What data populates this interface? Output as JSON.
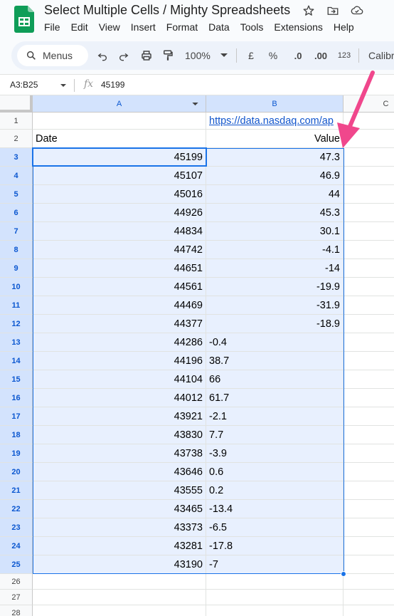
{
  "doc": {
    "title": "Select Multiple Cells / Mighty Spreadsheets",
    "star_icon": "star-icon",
    "move_icon": "move-to-folder-icon",
    "cloud_icon": "cloud-saved-icon"
  },
  "menubar": [
    "File",
    "Edit",
    "View",
    "Insert",
    "Format",
    "Data",
    "Tools",
    "Extensions",
    "Help"
  ],
  "toolbar": {
    "search_label": "Menus",
    "zoom": "100%",
    "currency": "£",
    "percent": "%",
    "decrease_decimal": ".0",
    "increase_decimal": ".00",
    "number_format": "123",
    "font": "Calibri"
  },
  "formula_bar": {
    "name_box": "A3:B25",
    "fx_symbol": "fx",
    "value": "45199"
  },
  "columns": [
    "A",
    "B",
    "C"
  ],
  "rows": [
    {
      "n": "1",
      "a": "",
      "b": "https://data.nasdaq.com/ap",
      "b_type": "link"
    },
    {
      "n": "2",
      "a": "Date",
      "a_type": "text",
      "b": "Value",
      "b_type": "num"
    },
    {
      "n": "3",
      "a": "45199",
      "b": "47.3",
      "b_type": "num"
    },
    {
      "n": "4",
      "a": "45107",
      "b": "46.9",
      "b_type": "num"
    },
    {
      "n": "5",
      "a": "45016",
      "b": "44",
      "b_type": "num"
    },
    {
      "n": "6",
      "a": "44926",
      "b": "45.3",
      "b_type": "num"
    },
    {
      "n": "7",
      "a": "44834",
      "b": "30.1",
      "b_type": "num"
    },
    {
      "n": "8",
      "a": "44742",
      "b": "-4.1",
      "b_type": "num"
    },
    {
      "n": "9",
      "a": "44651",
      "b": "-14",
      "b_type": "num"
    },
    {
      "n": "10",
      "a": "44561",
      "b": "-19.9",
      "b_type": "num"
    },
    {
      "n": "11",
      "a": "44469",
      "b": "-31.9",
      "b_type": "num"
    },
    {
      "n": "12",
      "a": "44377",
      "b": "-18.9",
      "b_type": "num"
    },
    {
      "n": "13",
      "a": "44286",
      "b": "-0.4",
      "b_type": "text"
    },
    {
      "n": "14",
      "a": "44196",
      "b": "38.7",
      "b_type": "text"
    },
    {
      "n": "15",
      "a": "44104",
      "b": "66",
      "b_type": "text"
    },
    {
      "n": "16",
      "a": "44012",
      "b": "61.7",
      "b_type": "text"
    },
    {
      "n": "17",
      "a": "43921",
      "b": "-2.1",
      "b_type": "text"
    },
    {
      "n": "18",
      "a": "43830",
      "b": "7.7",
      "b_type": "text"
    },
    {
      "n": "19",
      "a": "43738",
      "b": "-3.9",
      "b_type": "text"
    },
    {
      "n": "20",
      "a": "43646",
      "b": "0.6",
      "b_type": "text"
    },
    {
      "n": "21",
      "a": "43555",
      "b": "0.2",
      "b_type": "text"
    },
    {
      "n": "22",
      "a": "43465",
      "b": "-13.4",
      "b_type": "text"
    },
    {
      "n": "23",
      "a": "43373",
      "b": "-6.5",
      "b_type": "text"
    },
    {
      "n": "24",
      "a": "43281",
      "b": "-17.8",
      "b_type": "text"
    },
    {
      "n": "25",
      "a": "43190",
      "b": "-7",
      "b_type": "text"
    },
    {
      "n": "26",
      "a": "",
      "b": ""
    },
    {
      "n": "27",
      "a": "",
      "b": ""
    },
    {
      "n": "28",
      "a": "",
      "b": ""
    }
  ],
  "selection": {
    "first_row": 3,
    "last_row": 25,
    "columns": [
      "A",
      "B"
    ]
  },
  "colors": {
    "selection": "#1a73e8",
    "selection_fill": "#e8f0fe",
    "arrow": "#f0478c",
    "brand_green": "#0f9d58"
  }
}
